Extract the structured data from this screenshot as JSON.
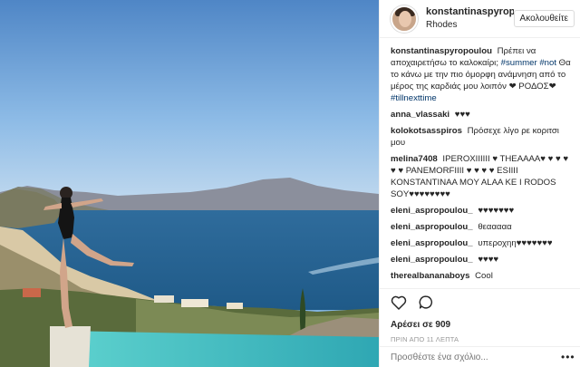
{
  "header": {
    "username": "konstantinaspyrop",
    "location": "Rhodes",
    "follow_label": "Ακολουθείτε"
  },
  "caption": {
    "username": "konstantinaspyropoulou",
    "text_1": "Πρέπει να αποχαιρετήσω το καλοκαίρι;",
    "tag_summer": "#summer",
    "tag_not": "#not",
    "text_2": "Θα το κάνω με την πιο όμορφη ανάμνηση από το μέρος της καρδιάς μου λοιπόν ❤ ΡΟΔΟΣ❤",
    "tag_tillnexttime": "#tillnexttime"
  },
  "comments": [
    {
      "username": "anna_vlassaki",
      "text": "♥♥♥"
    },
    {
      "username": "kolokotsasspiros",
      "text": "Πρόσεχε λίγο ρε κοριτσι μου"
    },
    {
      "username": "melina7408",
      "text": "IPEROXIIIIII ♥ THEAAAA♥ ♥ ♥ ♥ ♥ ♥ PANEMORFIIII ♥ ♥ ♥ ♥ ESIIII KONSTANTINAA MOY ALAA KE I RODOS SOY♥♥♥♥♥♥♥♥"
    },
    {
      "username": "eleni_aspropoulou_",
      "text": "♥♥♥♥♥♥♥"
    },
    {
      "username": "eleni_aspropoulou_",
      "text": "θεααααα"
    },
    {
      "username": "eleni_aspropoulou_",
      "text": "υπεροχηη♥♥♥♥♥♥♥"
    },
    {
      "username": "eleni_aspropoulou_",
      "text": "♥♥♥♥"
    },
    {
      "username": "therealbananaboys",
      "text": "Cool"
    }
  ],
  "actions": {
    "likes": "Αρέσει σε 909",
    "time": "ΠΡΙΝ ΑΠΟ 11 ΛΕΠΤΑ"
  },
  "add_comment": {
    "placeholder": "Προσθέστε ένα σχόλιο..."
  },
  "icons": {
    "like": "heart-icon",
    "comment": "speech-bubble-icon",
    "more": "more-options-icon"
  }
}
